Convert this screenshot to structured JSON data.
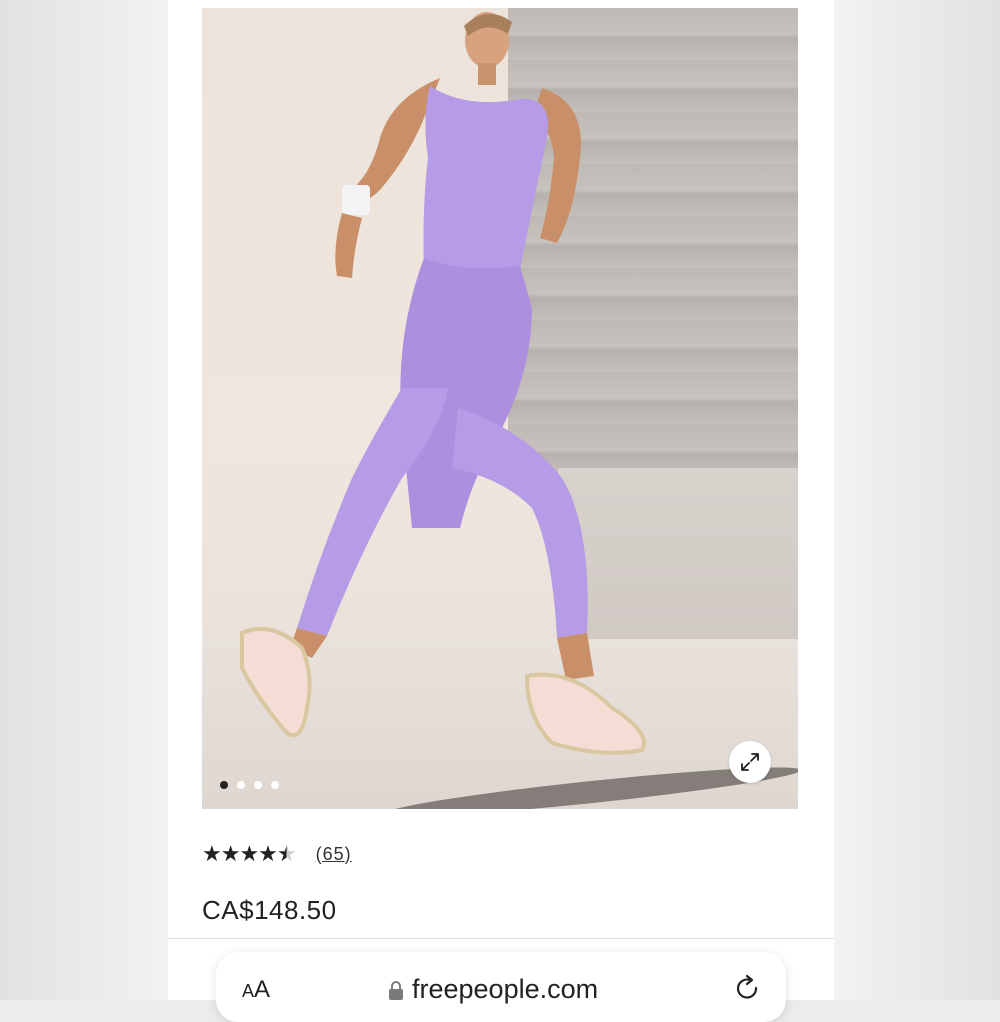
{
  "product": {
    "image_alt": "Woman running in lavender ribbed bodysuit",
    "carousel": {
      "total": 4,
      "active": 1
    },
    "rating": {
      "value": 4.5,
      "stars": "★★★★★",
      "count": "(65)"
    },
    "price": "CA$148.50"
  },
  "browser": {
    "text_size_label_small": "A",
    "text_size_label_large": "A",
    "url": "freepeople.com"
  },
  "colors": {
    "garment": "#b69be6",
    "wall": "#c2bcb8",
    "background": "#ececec"
  },
  "icons": [
    "expand-icon",
    "lock-icon",
    "reload-icon"
  ]
}
